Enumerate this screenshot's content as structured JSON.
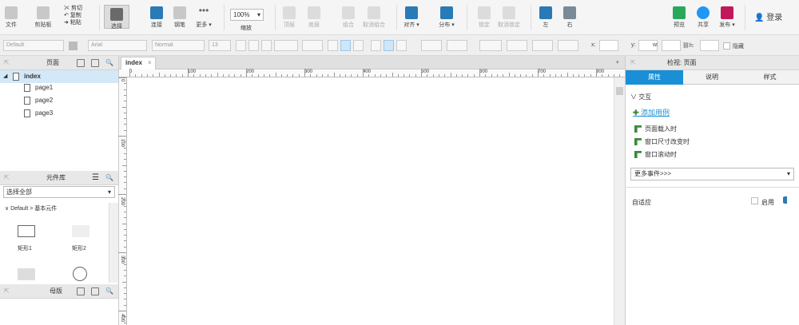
{
  "toolbar": {
    "file": "文件",
    "clipboard": "剪贴板",
    "cut": "剪切",
    "copy": "复制",
    "paste": "粘贴",
    "select": "选择",
    "connect": "连接",
    "pen": "钢笔",
    "more": "更多 ▾",
    "zoom_value": "100%",
    "zoom_label": "缩放",
    "top": "顶层",
    "bottom": "底层",
    "group": "组合",
    "ungroup": "取消组合",
    "align": "对齐 ▾",
    "distribute": "分布 ▾",
    "lock": "锁定",
    "unlock": "取消锁定",
    "left": "左",
    "right": "右",
    "preview": "预览",
    "share": "共享",
    "publish": "发布 ▾",
    "login": "登录"
  },
  "colors": {
    "accent": "#1a8fd6",
    "preview": "#2aa85a",
    "share": "#2196f3",
    "publish": "#c2185b",
    "gold": "#2a7ab5"
  },
  "formatbar": {
    "style": "Default",
    "font": "Arial",
    "weight": "Normal",
    "size": "13",
    "x_label": "x:",
    "y_label": "y:",
    "w_label": "w:",
    "h_label": "h:",
    "hidden_label": "隐藏"
  },
  "pages_panel": {
    "title": "页面",
    "items": [
      {
        "label": "index"
      },
      {
        "label": "page1"
      },
      {
        "label": "page2"
      },
      {
        "label": "page3"
      }
    ]
  },
  "library_panel": {
    "title": "元件库",
    "select": "选择全部",
    "group": "Default > 基本元件",
    "widgets": [
      {
        "label": "矩形1"
      },
      {
        "label": "矩形2"
      }
    ]
  },
  "masters_panel": {
    "title": "母版"
  },
  "canvas": {
    "tab": "index",
    "ruler_h": [
      "0",
      "100",
      "200",
      "300",
      "400",
      "500",
      "600",
      "700",
      "800"
    ],
    "ruler_v": [
      "0",
      "100",
      "200",
      "300",
      "400"
    ]
  },
  "inspector": {
    "title": "检视: 页面",
    "tabs": [
      "属性",
      "说明",
      "样式"
    ],
    "section": "交互",
    "add_case": "添加用例",
    "events": [
      "页面载入时",
      "窗口尺寸改变时",
      "窗口滚动时"
    ],
    "more_events": "更多事件>>>",
    "adaptive": "自适应",
    "enable": "启用"
  }
}
